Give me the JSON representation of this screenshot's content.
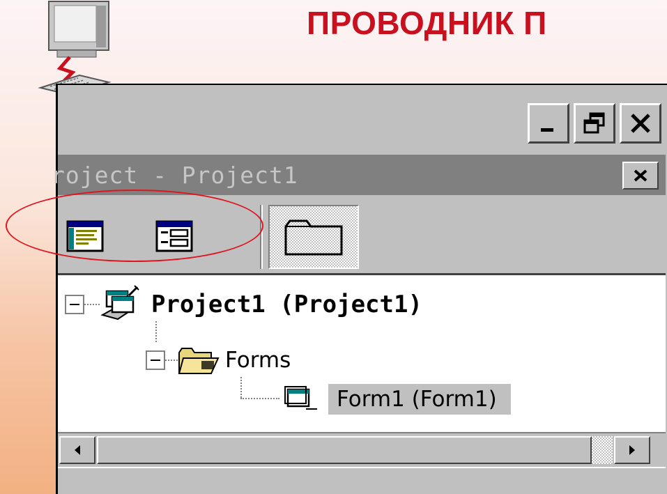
{
  "slide": {
    "title": "ПРОВОДНИК П",
    "accent_color": "#c8101e",
    "highlight_color": "#e0141e"
  },
  "window": {
    "controls": {
      "minimize_icon": "minimize-icon",
      "restore_icon": "restore-icon",
      "close_icon": "close-icon"
    },
    "project_explorer": {
      "title": "roject - Project1",
      "close_icon": "close-icon",
      "toolbar": {
        "buttons": [
          {
            "name": "view-code",
            "icon": "view-code-icon"
          },
          {
            "name": "view-object",
            "icon": "view-object-icon"
          },
          {
            "name": "toggle-folders",
            "icon": "folder-icon",
            "pressed": true
          }
        ]
      },
      "tree": {
        "project": {
          "label": "Project1 (Project1)",
          "icon": "project-icon",
          "expanded": true
        },
        "folder": {
          "label": "Forms",
          "icon": "open-folder-icon",
          "expanded": true
        },
        "form": {
          "label": "Form1 (Form1)",
          "icon": "form-icon",
          "selected": true
        }
      },
      "scrollbar": {
        "left_icon": "arrow-left-icon",
        "right_icon": "arrow-right-icon"
      }
    }
  }
}
